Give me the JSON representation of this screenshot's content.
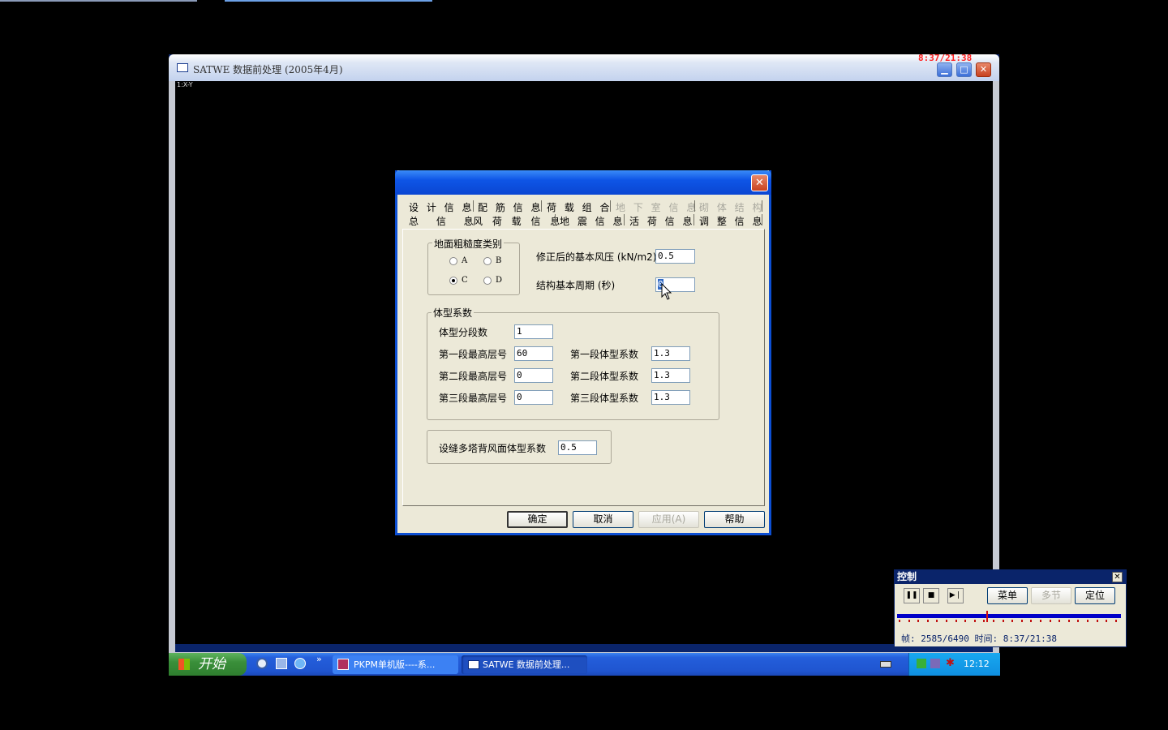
{
  "main_window": {
    "title": "SATWE 数据前处理 (2005年4月)",
    "recording_clock": "8:37/21:38",
    "corner_label": "1:X-Y"
  },
  "dialog": {
    "tabs_row1": [
      "设 计 信 息",
      "配 筋 信 息",
      "荷 载 组 合",
      "地 下 室 信 息",
      "砌 体 结 构"
    ],
    "tabs_row2": [
      "总 信 息",
      "风 荷 载 信 息",
      "地 震 信 息",
      "活 荷 信 息",
      "调 整 信 息"
    ],
    "roughness": {
      "title": "地面粗糙度类别",
      "options": [
        "A",
        "B",
        "C",
        "D"
      ],
      "selected": "C"
    },
    "wind_pressure_label": "修正后的基本风压 (kN/m2)",
    "wind_pressure_value": "0.5",
    "period_label": "结构基本周期 (秒)",
    "period_value": "0",
    "shape": {
      "title": "体型系数",
      "segments_label": "体型分段数",
      "segments_value": "1",
      "rows": [
        {
          "floor_label": "第一段最高层号",
          "floor_value": "60",
          "coef_label": "第一段体型系数",
          "coef_value": "1.3"
        },
        {
          "floor_label": "第二段最高层号",
          "floor_value": "0",
          "coef_label": "第二段体型系数",
          "coef_value": "1.3"
        },
        {
          "floor_label": "第三段最高层号",
          "floor_value": "0",
          "coef_label": "第三段体型系数",
          "coef_value": "1.3"
        }
      ]
    },
    "multi_tower_label": "设缝多塔背风面体型系数",
    "multi_tower_value": "0.5",
    "buttons": {
      "ok": "确定",
      "cancel": "取消",
      "apply": "应用(A)",
      "help": "帮助"
    }
  },
  "taskbar": {
    "start": "开始",
    "tasks": [
      "PKPM单机版----系...",
      "SATWE 数据前处理..."
    ],
    "time": "12:12"
  },
  "control": {
    "title": "控制",
    "buttons": [
      "菜单",
      "多节",
      "定位"
    ],
    "status": "帧: 2585/6490 时间: 8:37/21:38",
    "progress": 0.3983
  }
}
